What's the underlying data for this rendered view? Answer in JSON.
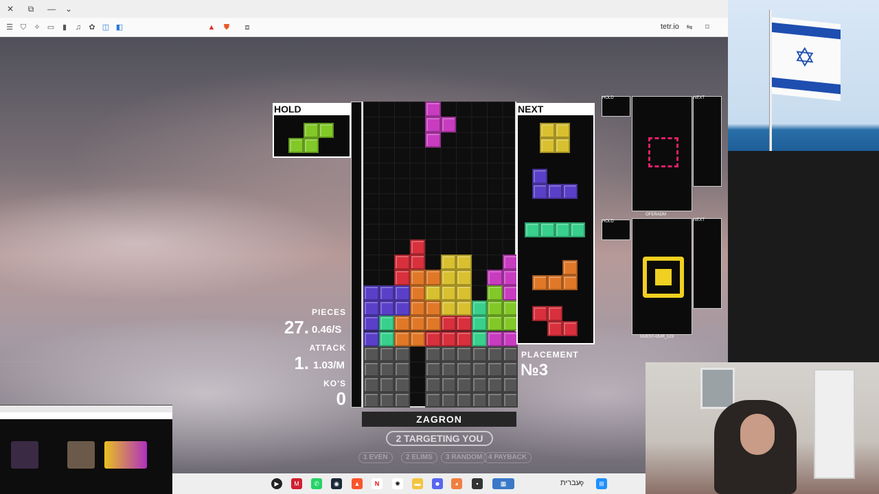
{
  "browser": {
    "url": "tetr.io",
    "window_buttons": [
      "✕",
      "⧉",
      "—",
      "⌄"
    ]
  },
  "game": {
    "hold_label": "HOLD",
    "next_label": "NEXT",
    "hold_piece": "S",
    "next_queue": [
      "O",
      "J",
      "I",
      "L",
      "Z"
    ],
    "stats": {
      "pieces_label": "PIECES",
      "pieces_value": "27.",
      "pieces_rate": "0.46/S",
      "attack_label": "ATTACK",
      "attack_value": "1.",
      "attack_rate": "1.03/M",
      "kos_label": "KO'S",
      "kos_value": "0"
    },
    "placement_label": "PLACEMENT",
    "placement_value": "№3",
    "player_name": "ZAGRON",
    "targeting": "2 TARGETING YOU",
    "strategies": [
      "1 EVEN",
      "2 ELIMS",
      "3 RANDOM",
      "4 PAYBACK"
    ],
    "opponents": [
      {
        "name": "OFERADM",
        "hold_label": "HOLD",
        "next_label": "NEXT"
      },
      {
        "name": "GUEST-OUR_123",
        "hold_label": "HOLD",
        "next_label": "NEXT"
      }
    ],
    "colors": {
      "S": "#82c828",
      "Z": "#d8303c",
      "J": "#5a40c8",
      "L": "#e07828",
      "O": "#d8c030",
      "I": "#38d08c",
      "T": "#c83cc0",
      "garbage": "#555555"
    }
  },
  "taskbar": {
    "lang": "עברית"
  }
}
